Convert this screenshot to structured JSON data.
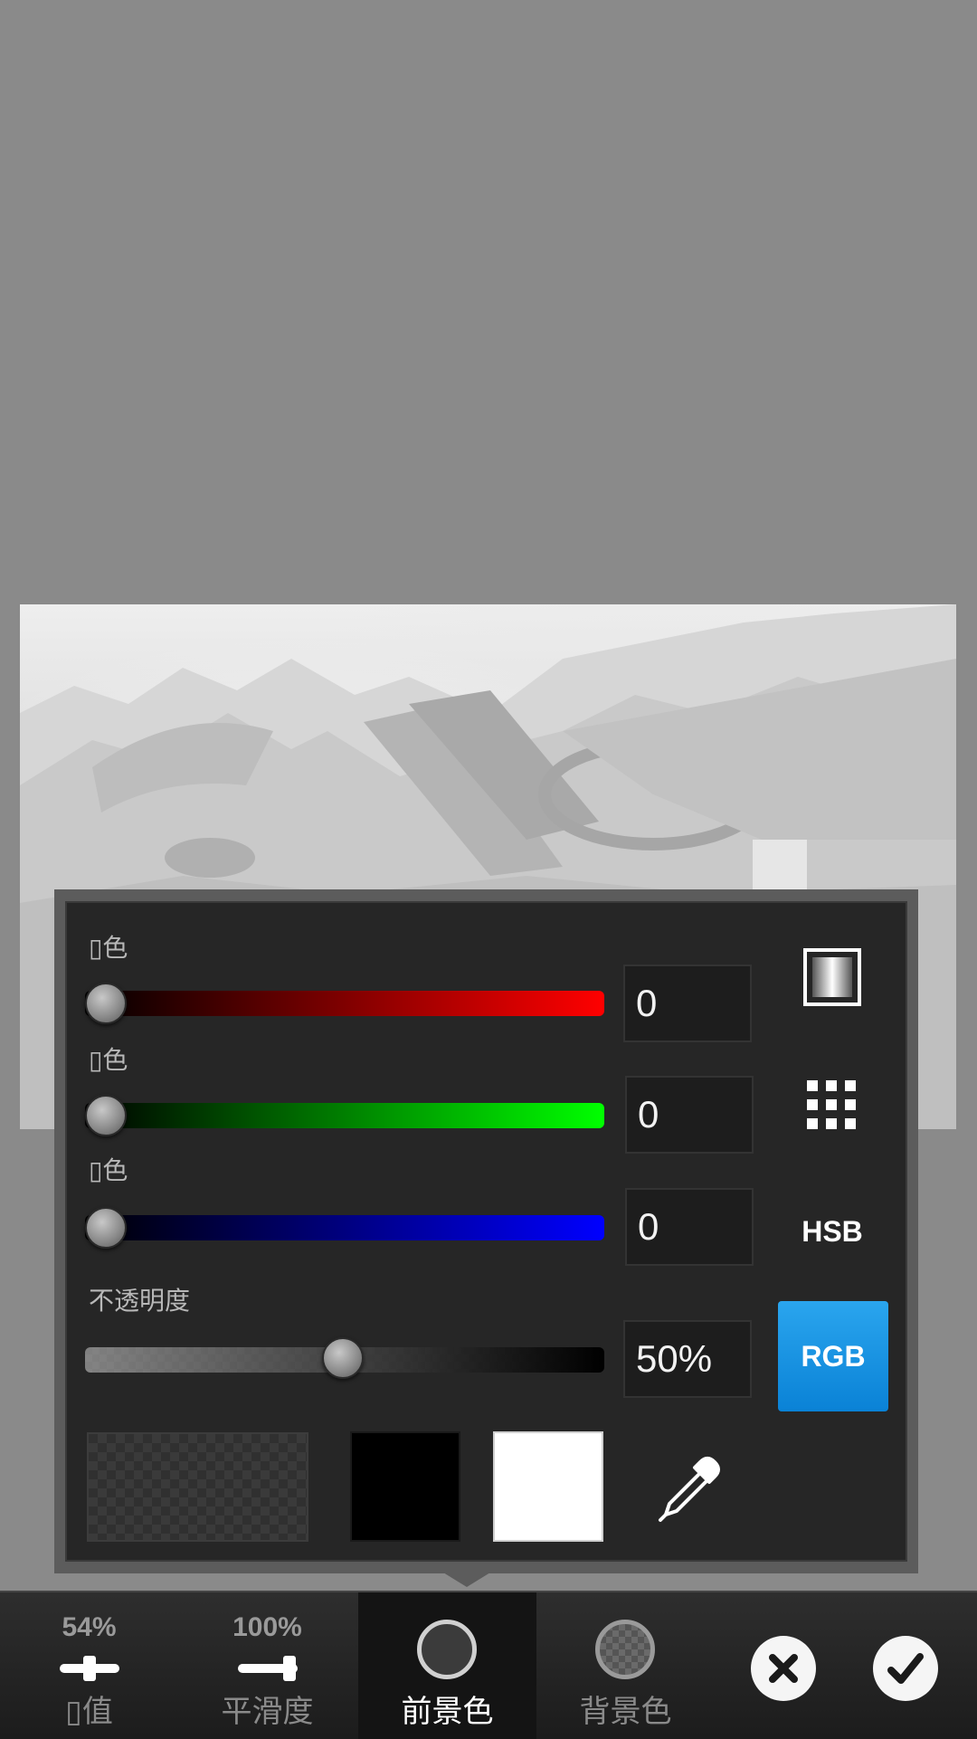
{
  "panel": {
    "red_label": "▯色",
    "green_label": "▯色",
    "blue_label": "▯色",
    "opacity_label": "不透明度",
    "red_value": "0",
    "green_value": "0",
    "blue_value": "0",
    "opacity_value": "50%",
    "opacity_level_percent": 50,
    "hsb_label": "HSB",
    "rgb_label": "RGB",
    "gradient_icon": "gradient-icon",
    "grid_icon": "grid-icon",
    "eyedropper_icon": "eyedropper-icon",
    "colors": {
      "rgb_button": "#1592e0",
      "black_swatch": "#000000",
      "white_swatch": "#ffffff",
      "panel_bg": "#262626"
    }
  },
  "toolbar": {
    "threshold": {
      "percent": "54%",
      "label": "▯值",
      "level_percent": 54
    },
    "smoothness": {
      "percent": "100%",
      "label": "平滑度",
      "level_percent": 100
    },
    "foreground": {
      "label": "前景色"
    },
    "background": {
      "label": "背景色"
    },
    "cancel_icon": "close-icon",
    "confirm_icon": "check-icon"
  }
}
